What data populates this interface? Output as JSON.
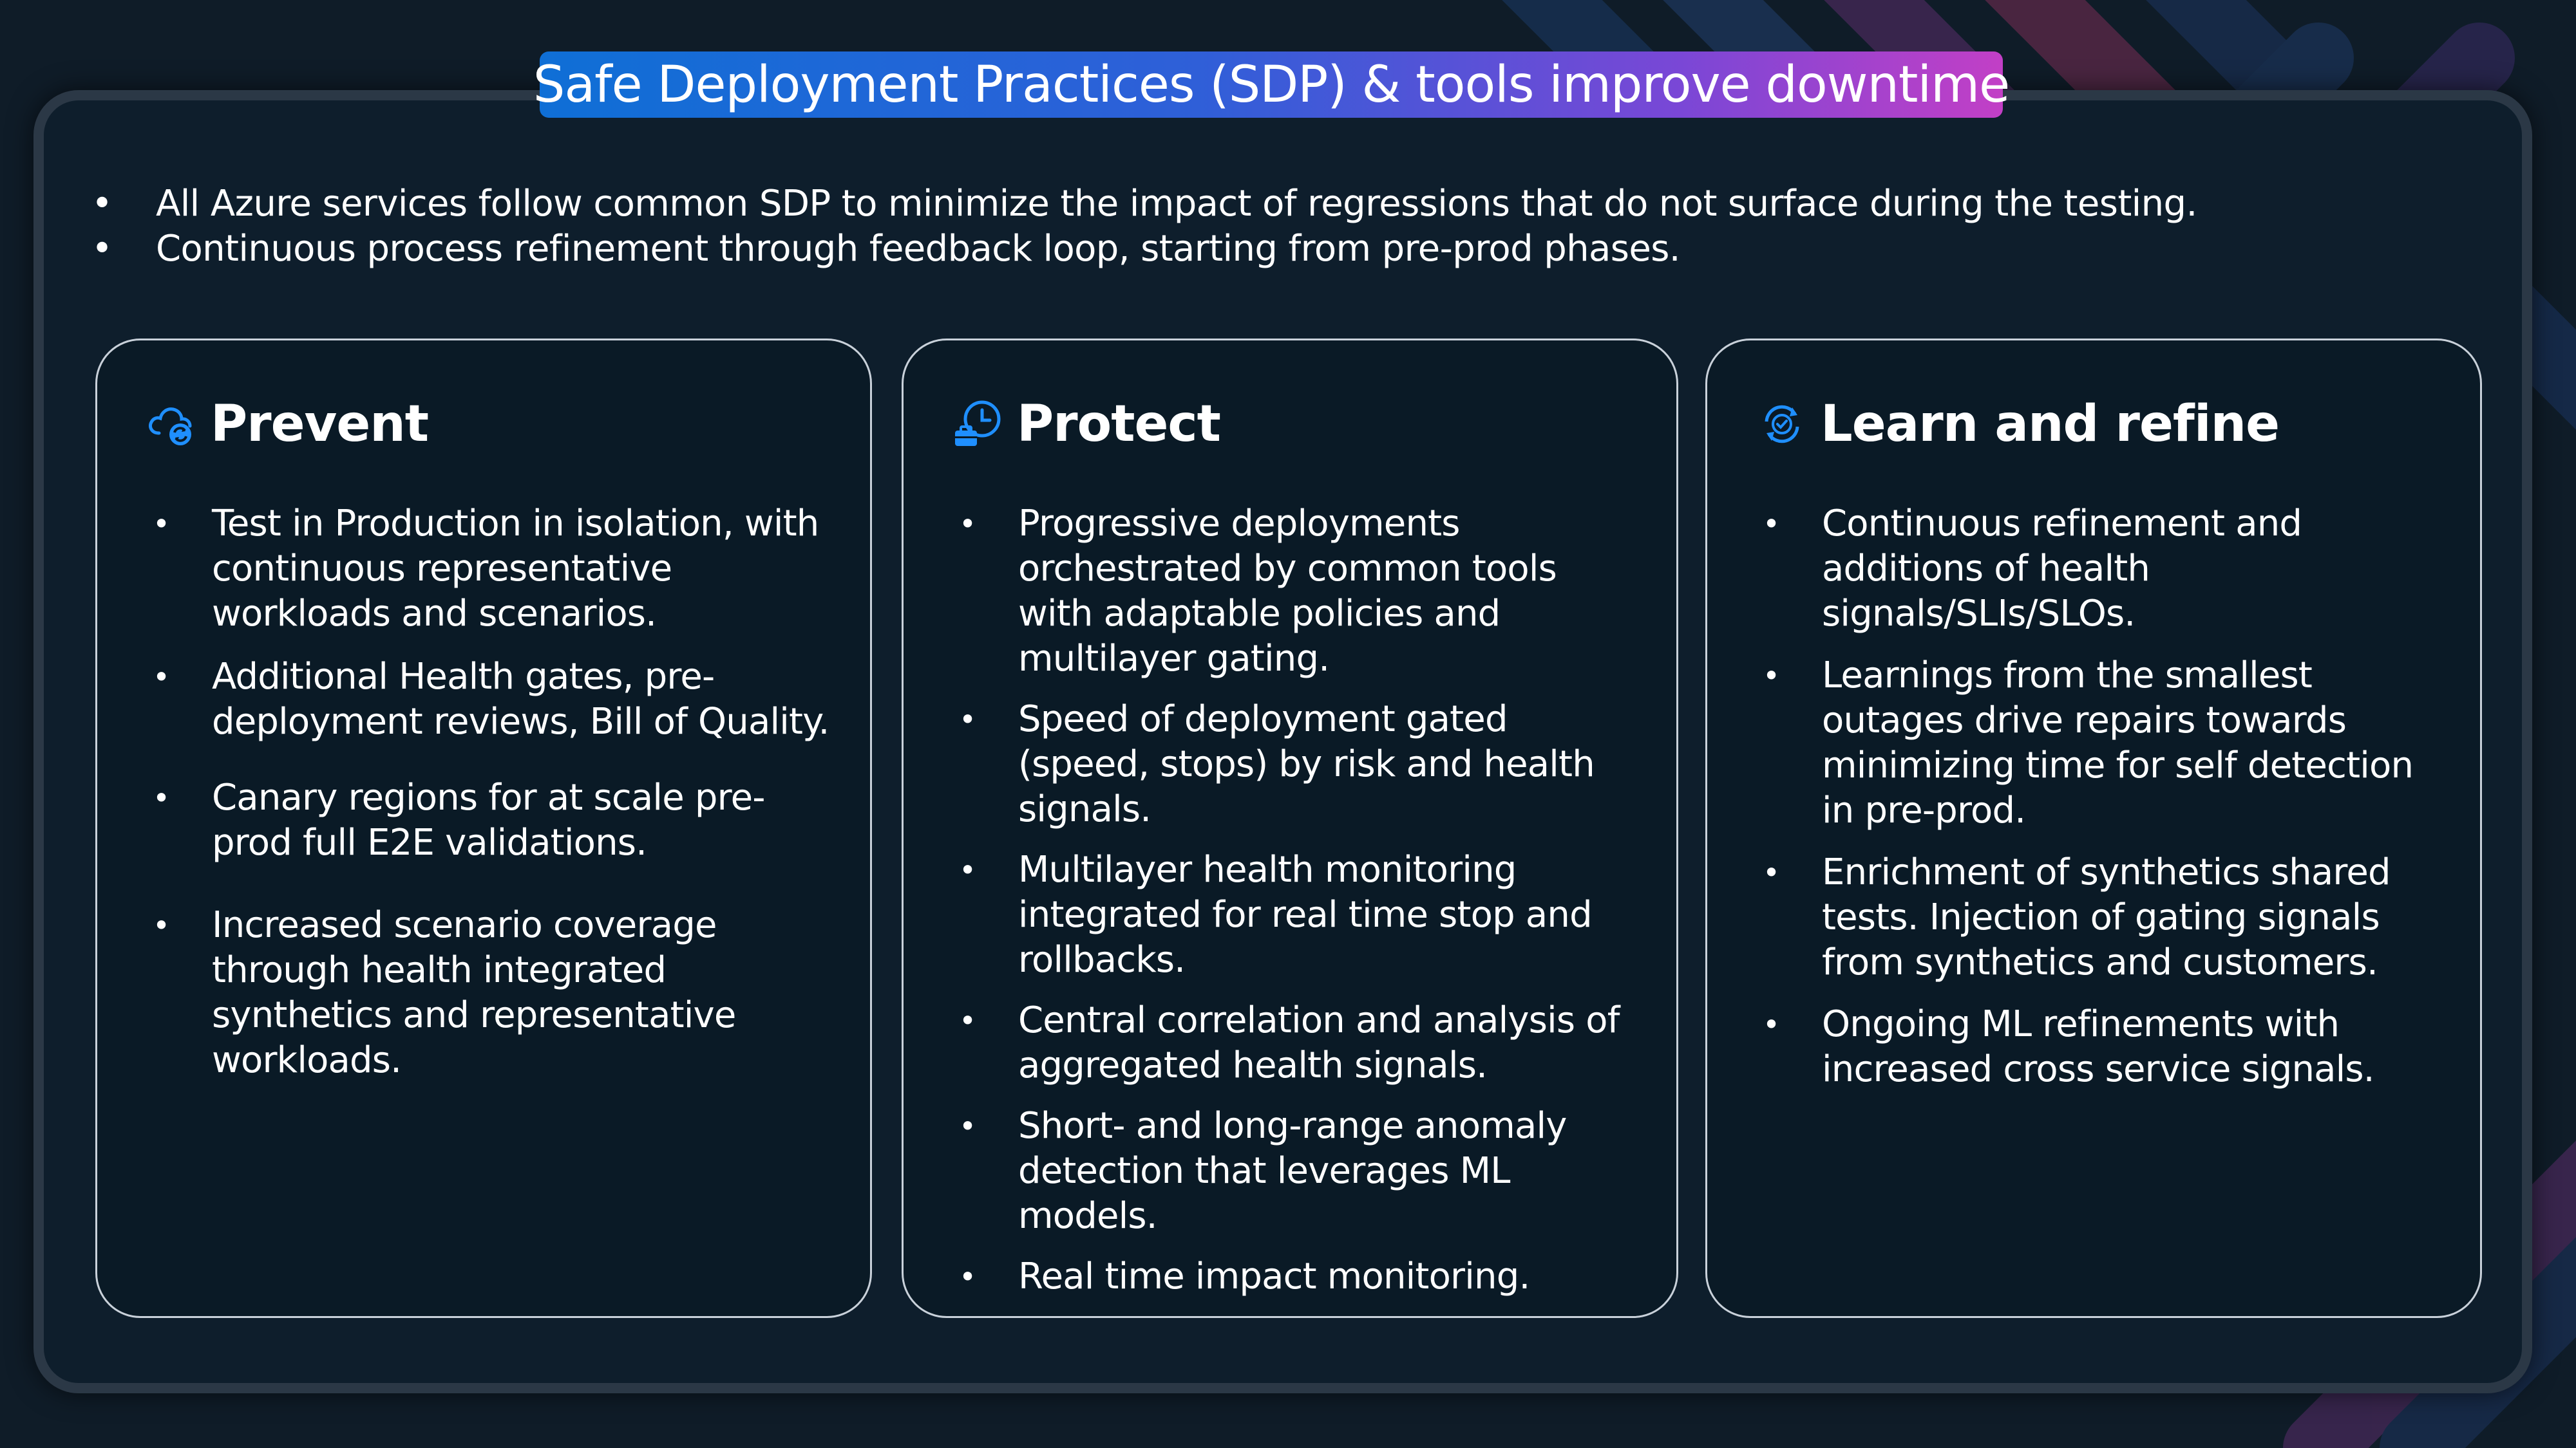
{
  "title": "Safe Deployment Practices (SDP) & tools improve downtime",
  "intro_bullets": [
    "All Azure services follow common SDP to minimize the impact of regressions that do not surface during the testing.",
    "Continuous process refinement through feedback loop, starting from pre-prod phases."
  ],
  "colors": {
    "background": "#0f1c28",
    "accent_blue": "#0f6fd6",
    "accent_purple": "#c23fc6",
    "icon_blue": "#1f8fff"
  },
  "cards": [
    {
      "title": "Prevent",
      "icon": "cloud-refresh-icon",
      "bullets": [
        "Test in Production in isolation, with continuous representative workloads and scenarios.",
        "Additional Health gates, pre-deployment reviews, Bill of Quality.",
        "Canary regions for at scale pre-prod full E2E validations.",
        "Increased scenario coverage through health integrated synthetics and representative workloads."
      ]
    },
    {
      "title": "Protect",
      "icon": "clock-toolbox-icon",
      "bullets": [
        "Progressive deployments orchestrated by common tools with adaptable policies and multilayer gating.",
        "Speed of deployment gated (speed, stops) by risk and health signals.",
        "Multilayer health monitoring integrated for real time stop and rollbacks.",
        "Central correlation and analysis of aggregated health signals.",
        "Short- and long-range anomaly detection that leverages ML models.",
        "Real time impact monitoring."
      ]
    },
    {
      "title": "Learn and refine",
      "icon": "sync-check-icon",
      "bullets": [
        "Continuous refinement and additions of health signals/SLIs/SLOs.",
        "Learnings from the smallest outages drive repairs towards minimizing time for self detection in pre-prod.",
        "Enrichment of synthetics shared tests. Injection of gating signals from synthetics and customers.",
        "Ongoing ML refinements with increased cross service signals."
      ]
    }
  ]
}
